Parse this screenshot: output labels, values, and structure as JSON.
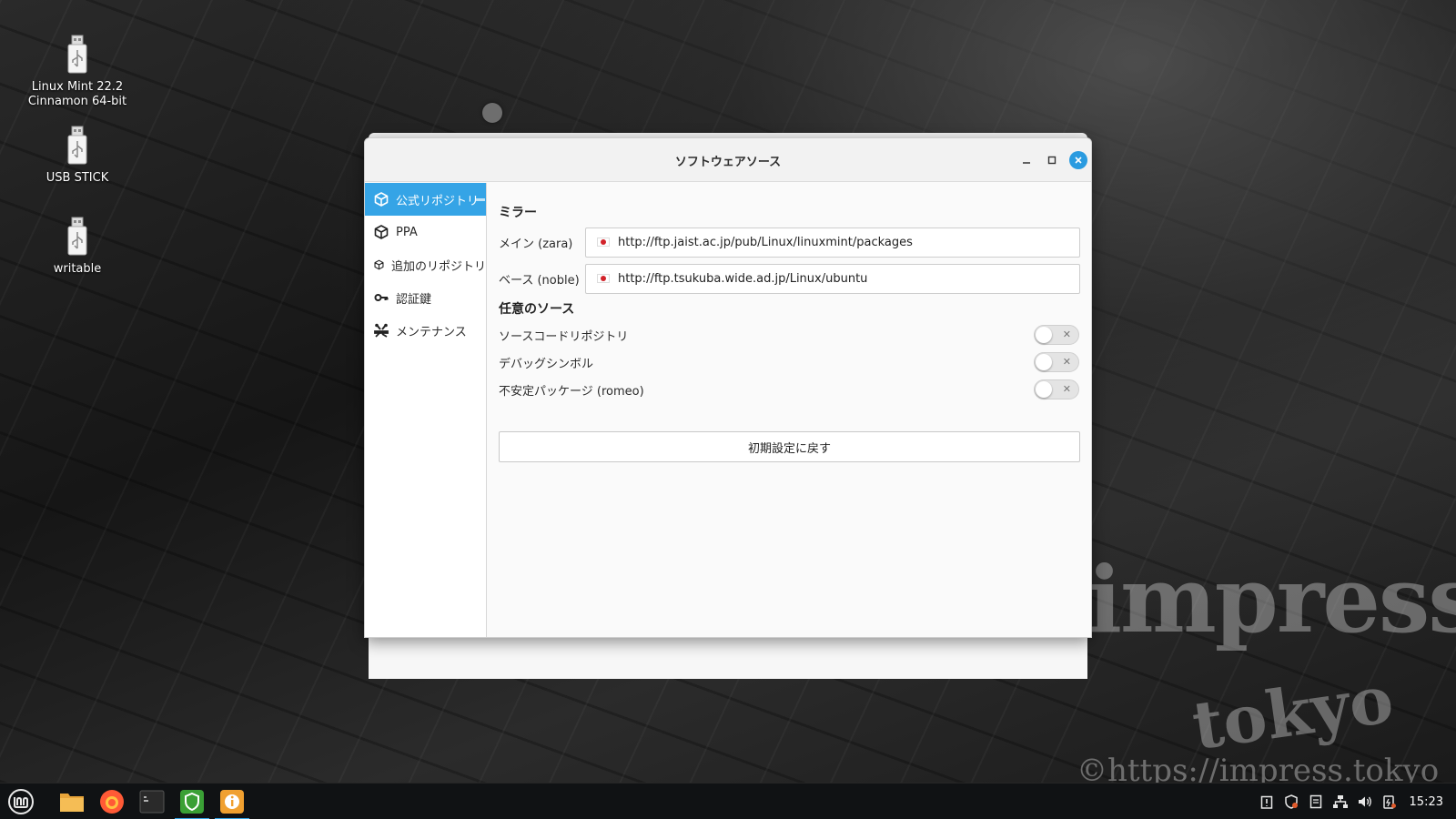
{
  "desktop": {
    "icons": [
      {
        "label_line1": "Linux Mint 22.2",
        "label_line2": "Cinnamon 64-bit"
      },
      {
        "label_line1": "USB STICK",
        "label_line2": ""
      },
      {
        "label_line1": "writable",
        "label_line2": ""
      }
    ],
    "watermark": {
      "line1": "impress",
      "line2": "tokyo",
      "line3": "©https://impress.tokyo"
    }
  },
  "window": {
    "title": "ソフトウェアソース",
    "buttons": {
      "minimize": "–",
      "maximize": "□",
      "close": "✕"
    },
    "sidebar": [
      {
        "label": "公式リポジトリ",
        "icon": "package-icon",
        "active": true
      },
      {
        "label": "PPA",
        "icon": "package-icon",
        "active": false
      },
      {
        "label": "追加のリポジトリ",
        "icon": "package-icon",
        "active": false
      },
      {
        "label": "認証鍵",
        "icon": "key-icon",
        "active": false
      },
      {
        "label": "メンテナンス",
        "icon": "tools-icon",
        "active": false
      }
    ],
    "mirrors": {
      "heading": "ミラー",
      "main": {
        "label": "メイン (zara)",
        "url": "http://ftp.jaist.ac.jp/pub/Linux/linuxmint/packages"
      },
      "base": {
        "label": "ベース (noble)",
        "url": "http://ftp.tsukuba.wide.ad.jp/Linux/ubuntu"
      }
    },
    "optional": {
      "heading": "任意のソース",
      "items": [
        {
          "label": "ソースコードリポジトリ",
          "enabled": false
        },
        {
          "label": "デバッグシンボル",
          "enabled": false
        },
        {
          "label": "不安定パッケージ (romeo)",
          "enabled": false
        }
      ]
    },
    "reset_label": "初期設定に戻す"
  },
  "taskbar": {
    "apps": [
      "mint-menu-icon",
      "folder-icon",
      "firefox-icon",
      "terminal-icon",
      "shield-icon",
      "info-icon"
    ],
    "clock": "15:23"
  },
  "colors": {
    "accent": "#35a4e6",
    "flag_red": "#d2232a"
  }
}
